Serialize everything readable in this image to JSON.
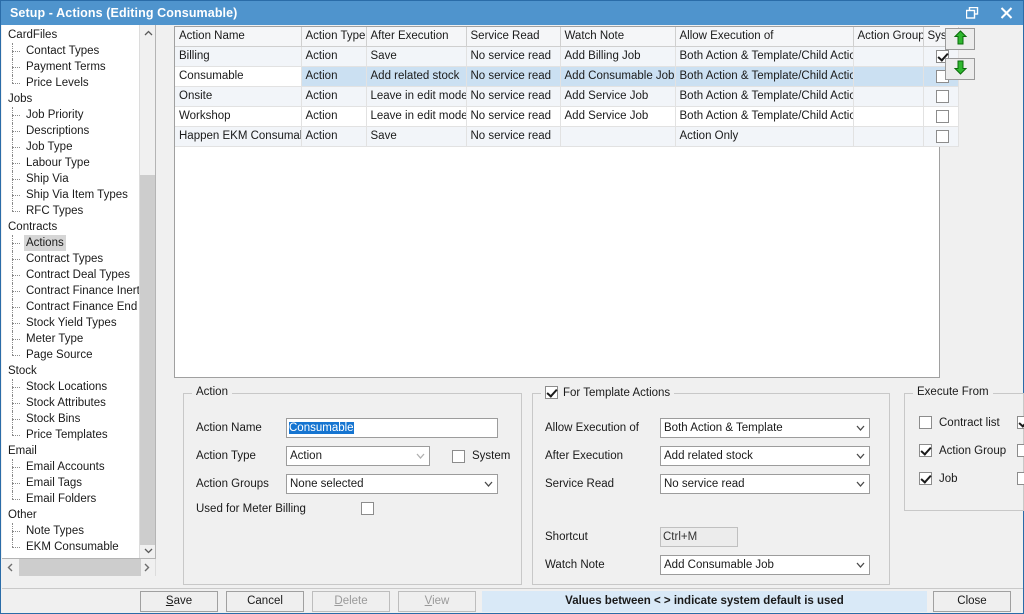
{
  "window": {
    "title": "Setup - Actions (Editing Consumable)",
    "restore_icon": "restore-window-icon",
    "close_icon": "close-icon",
    "titlebar_color": "#4f94cd"
  },
  "sidebar": {
    "nodes": [
      {
        "label": "CardFiles",
        "level": 0,
        "selected": false
      },
      {
        "label": "Contact Types",
        "level": 1,
        "selected": false
      },
      {
        "label": "Payment Terms",
        "level": 1,
        "selected": false
      },
      {
        "label": "Price Levels",
        "level": 1,
        "selected": false,
        "last": true
      },
      {
        "label": "Jobs",
        "level": 0,
        "selected": false
      },
      {
        "label": "Job Priority",
        "level": 1,
        "selected": false
      },
      {
        "label": "Descriptions",
        "level": 1,
        "selected": false
      },
      {
        "label": "Job Type",
        "level": 1,
        "selected": false
      },
      {
        "label": "Labour Type",
        "level": 1,
        "selected": false
      },
      {
        "label": "Ship Via",
        "level": 1,
        "selected": false
      },
      {
        "label": "Ship Via Item Types",
        "level": 1,
        "selected": false
      },
      {
        "label": "RFC Types",
        "level": 1,
        "selected": false,
        "last": true
      },
      {
        "label": "Contracts",
        "level": 0,
        "selected": false
      },
      {
        "label": "Actions",
        "level": 1,
        "selected": true
      },
      {
        "label": "Contract Types",
        "level": 1,
        "selected": false
      },
      {
        "label": "Contract Deal Types",
        "level": 1,
        "selected": false
      },
      {
        "label": "Contract Finance Inertia",
        "level": 1,
        "selected": false
      },
      {
        "label": "Contract Finance End of Te",
        "level": 1,
        "selected": false
      },
      {
        "label": "Stock Yield Types",
        "level": 1,
        "selected": false
      },
      {
        "label": "Meter Type",
        "level": 1,
        "selected": false
      },
      {
        "label": "Page Source",
        "level": 1,
        "selected": false,
        "last": true
      },
      {
        "label": "Stock",
        "level": 0,
        "selected": false
      },
      {
        "label": "Stock Locations",
        "level": 1,
        "selected": false
      },
      {
        "label": "Stock Attributes",
        "level": 1,
        "selected": false
      },
      {
        "label": "Stock Bins",
        "level": 1,
        "selected": false
      },
      {
        "label": "Price Templates",
        "level": 1,
        "selected": false,
        "last": true
      },
      {
        "label": "Email",
        "level": 0,
        "selected": false
      },
      {
        "label": "Email Accounts",
        "level": 1,
        "selected": false
      },
      {
        "label": "Email Tags",
        "level": 1,
        "selected": false
      },
      {
        "label": "Email Folders",
        "level": 1,
        "selected": false,
        "last": true
      },
      {
        "label": "Other",
        "level": 0,
        "selected": false
      },
      {
        "label": "Note Types",
        "level": 1,
        "selected": false
      },
      {
        "label": "EKM Consumable",
        "level": 1,
        "selected": false,
        "last": true
      }
    ],
    "scroll_up_icon": "chevron-up-icon",
    "scroll_down_icon": "chevron-down-icon",
    "scroll_left_icon": "chevron-left-icon",
    "scroll_right_icon": "chevron-right-icon"
  },
  "grid": {
    "columns": [
      "Action Name",
      "Action Type",
      "After Execution",
      "Service Read",
      "Watch Note",
      "Allow Execution of",
      "Action Groups",
      "System"
    ],
    "rows": [
      {
        "name": "Billing",
        "type": "Action",
        "after_execution": "Save",
        "service_read": "No service read",
        "watch_note": "Add Billing Job",
        "allow_execution_of": "Both Action & Template/Child Action",
        "action_groups": "",
        "system": true,
        "selected": false,
        "stripe": "alt"
      },
      {
        "name": "Consumable",
        "type": "Action",
        "after_execution": "Add related stock",
        "service_read": "No service read",
        "watch_note": "Add Consumable Job",
        "allow_execution_of": "Both Action & Template/Child Action",
        "action_groups": "",
        "system": false,
        "selected": true,
        "stripe": "sel"
      },
      {
        "name": "Onsite",
        "type": "Action",
        "after_execution": "Leave in edit mode",
        "service_read": "No service read",
        "watch_note": "Add Service Job",
        "allow_execution_of": "Both Action & Template/Child Action",
        "action_groups": "",
        "system": false,
        "selected": false,
        "stripe": "alt"
      },
      {
        "name": "Workshop",
        "type": "Action",
        "after_execution": "Leave in edit mode",
        "service_read": "No service read",
        "watch_note": "Add Service Job",
        "allow_execution_of": "Both Action & Template/Child Action",
        "action_groups": "",
        "system": false,
        "selected": false,
        "stripe": "plain"
      },
      {
        "name": "Happen EKM Consumable",
        "type": "Action",
        "after_execution": "Save",
        "service_read": "No service read",
        "watch_note": "",
        "allow_execution_of": "Action Only",
        "action_groups": "",
        "system": false,
        "selected": false,
        "stripe": "alt"
      }
    ],
    "move_up_icon": "arrow-up-icon",
    "move_down_icon": "arrow-down-icon",
    "move_arrow_color": "#1f9b1f"
  },
  "action_panel": {
    "legend": "Action",
    "action_name_label": "Action Name",
    "action_name_value": "Consumable",
    "action_type_label": "Action Type",
    "action_type_value": "Action",
    "system_label": "System",
    "system_checked": false,
    "action_groups_label": "Action Groups",
    "action_groups_value": "None selected",
    "meter_billing_label": "Used for Meter Billing",
    "meter_billing_checked": false
  },
  "template_panel": {
    "legend": "For Template Actions",
    "legend_checked": true,
    "allow_execution_label": "Allow Execution of",
    "allow_execution_value": "Both Action & Template",
    "after_execution_label": "After Execution",
    "after_execution_value": "Add related stock",
    "service_read_label": "Service Read",
    "service_read_value": "No service read",
    "shortcut_label": "Shortcut",
    "shortcut_value": "Ctrl+M",
    "watch_note_label": "Watch Note",
    "watch_note_value": "Add Consumable Job"
  },
  "execute_panel": {
    "legend": "Execute From",
    "rows": [
      {
        "label": "Contract list",
        "checked": false,
        "second_checked": true
      },
      {
        "label": "Action Group",
        "checked": true,
        "second_checked": false
      },
      {
        "label": "Job",
        "checked": true,
        "second_checked": false
      }
    ]
  },
  "buttonbar": {
    "save": "Save",
    "cancel": "Cancel",
    "delete": "Delete",
    "view": "View",
    "status": "Values between < > indicate system default is used",
    "close": "Close"
  }
}
